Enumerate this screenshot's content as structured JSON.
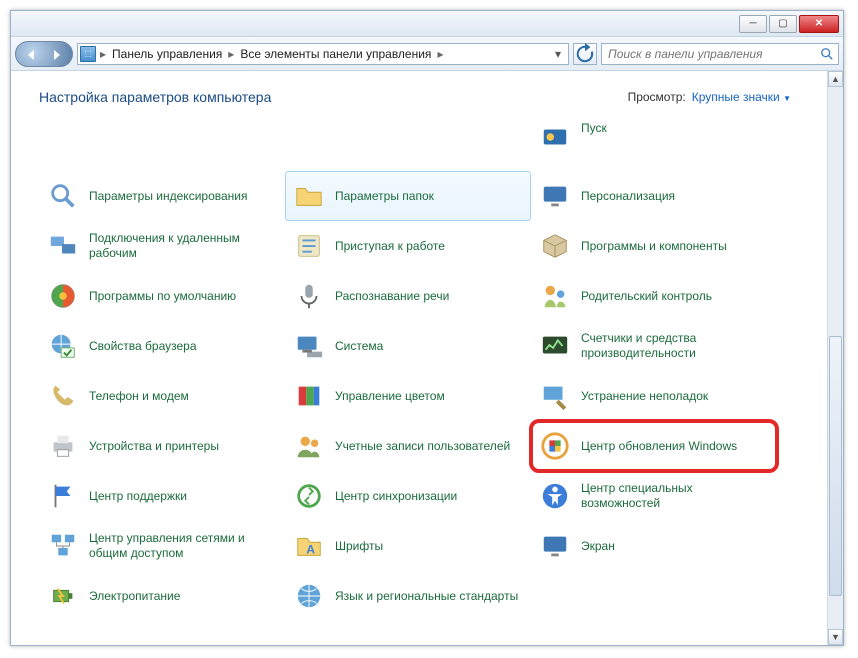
{
  "breadcrumb": {
    "item1": "Панель управления",
    "item2": "Все элементы панели управления"
  },
  "search": {
    "placeholder": "Поиск в панели управления"
  },
  "header": {
    "title": "Настройка параметров компьютера",
    "view_label": "Просмотр:",
    "view_value": "Крупные значки"
  },
  "items": {
    "r0c2_truncated": "Пуск",
    "r1c0": "Параметры индексирования",
    "r1c1": "Параметры папок",
    "r1c2": "Персонализация",
    "r2c0": "Подключения к удаленным рабочим",
    "r2c1": "Приступая к работе",
    "r2c2": "Программы и компоненты",
    "r3c0": "Программы по умолчанию",
    "r3c1": "Распознавание речи",
    "r3c2": "Родительский контроль",
    "r4c0": "Свойства браузера",
    "r4c1": "Система",
    "r4c2": "Счетчики и средства производительности",
    "r5c0": "Телефон и модем",
    "r5c1": "Управление цветом",
    "r5c2": "Устранение неполадок",
    "r6c0": "Устройства и принтеры",
    "r6c1": "Учетные записи пользователей",
    "r6c2": "Центр обновления Windows",
    "r7c0": "Центр поддержки",
    "r7c1": "Центр синхронизации",
    "r7c2": "Центр специальных возможностей",
    "r8c0": "Центр управления сетями и общим доступом",
    "r8c1": "Шрифты",
    "r8c2": "Экран",
    "r9c0": "Электропитание",
    "r9c1": "Язык и региональные стандарты"
  }
}
